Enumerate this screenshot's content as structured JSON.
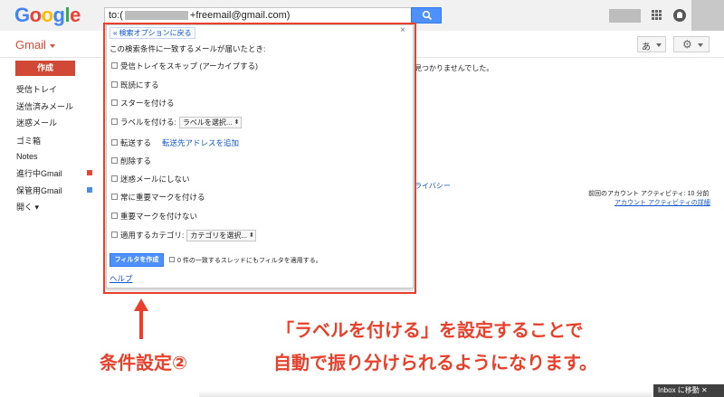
{
  "header": {
    "logo_letters": [
      {
        "ch": "G",
        "color": "#4285f4"
      },
      {
        "ch": "o",
        "color": "#ea4335"
      },
      {
        "ch": "o",
        "color": "#fbbc05"
      },
      {
        "ch": "g",
        "color": "#4285f4"
      },
      {
        "ch": "l",
        "color": "#34a853"
      },
      {
        "ch": "e",
        "color": "#ea4335"
      }
    ],
    "search_prefix": "to:(",
    "search_suffix": "+freemail@gmail.com)"
  },
  "toolbar": {
    "app_label": "Gmail",
    "ime_label": "あ",
    "settings_icon": "gear-icon"
  },
  "sidebar": {
    "compose_label": "作成",
    "items": [
      {
        "label": "受信トレイ"
      },
      {
        "label": "送信済みメール"
      },
      {
        "label": "迷惑メール"
      },
      {
        "label": "ゴミ箱"
      },
      {
        "label": "Notes"
      },
      {
        "label": "進行中Gmail",
        "color": "#e2493b"
      },
      {
        "label": "保管用Gmail",
        "color": "#4a90d9"
      },
      {
        "label": "開く ▾"
      }
    ]
  },
  "main": {
    "no_results_tail": "見つかりませんでした。",
    "privacy_fragment": "ライバシー",
    "last_activity": "前回のアカウント アクティビティ: 10 分前",
    "activity_details": "アカウント アクティビティの詳細"
  },
  "dialog": {
    "back_link": "« 検索オプションに戻る",
    "close": "×",
    "heading": "この検索条件に一致するメールが届いたとき:",
    "options": {
      "skip_inbox": "受信トレイをスキップ (アーカイブする)",
      "mark_read": "既読にする",
      "star": "スターを付ける",
      "apply_label": "ラベルを付ける:",
      "label_select": "ラベルを選択...",
      "forward": "転送する",
      "forward_add": "転送先アドレスを追加",
      "delete": "削除する",
      "never_spam": "迷惑メールにしない",
      "always_important": "常に重要マークを付ける",
      "never_important": "重要マークを付けない",
      "categorize": "適用するカテゴリ:",
      "category_select": "カテゴリを選択..."
    },
    "create_filter": "フィルタを作成",
    "apply_existing": "0 件の一致するスレッドにもフィルタを適用する。",
    "help": "ヘルプ"
  },
  "annotation": {
    "step_label": "条件設定②",
    "caption_line1": "「ラベルを付ける」を設定することで",
    "caption_line2": "自動で振り分けられるようになります。"
  },
  "bottom": {
    "inbox_move": "Inbox に移動 ✕"
  }
}
